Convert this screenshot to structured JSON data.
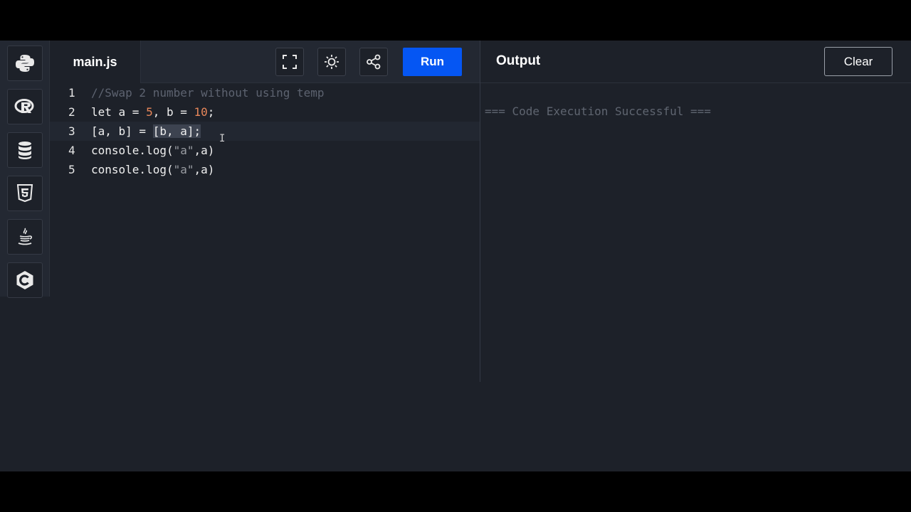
{
  "sidebar": {
    "languages": [
      {
        "name": "python-icon"
      },
      {
        "name": "r-icon"
      },
      {
        "name": "database-icon"
      },
      {
        "name": "html5-icon"
      },
      {
        "name": "java-icon"
      },
      {
        "name": "c-icon"
      }
    ]
  },
  "editor": {
    "tab_label": "main.js",
    "run_label": "Run",
    "line_numbers": [
      "1",
      "2",
      "3",
      "4",
      "5"
    ],
    "lines": {
      "l1": "//Swap 2 number without using temp",
      "l2_a": "let a = ",
      "l2_n1": "5",
      "l2_b": ", b = ",
      "l2_n2": "10",
      "l2_c": ";",
      "l3_a": "[a, b] = ",
      "l3_sel": "[b, a];",
      "l4_a": "console.log(",
      "l4_s": "\"a\"",
      "l4_b": ",a)",
      "l5_a": "console.log(",
      "l5_s": "\"a\"",
      "l5_b": ",a)"
    }
  },
  "output": {
    "title": "Output",
    "clear_label": "Clear",
    "text": "=== Code Execution Successful ==="
  },
  "colors": {
    "accent": "#0556f3",
    "background": "#1d2129",
    "number": "#e8875a"
  }
}
